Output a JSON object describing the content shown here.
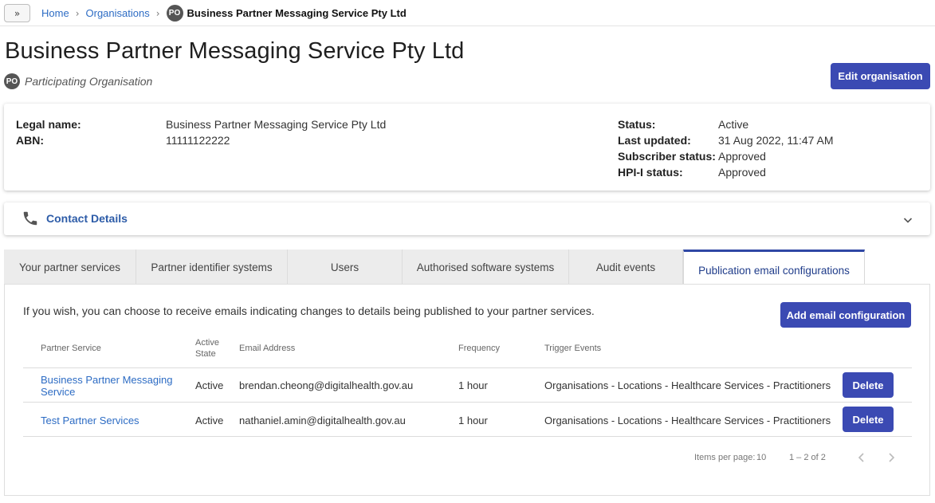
{
  "breadcrumb": {
    "expand_label": "»",
    "home": "Home",
    "organisations": "Organisations",
    "badge": "PO",
    "current": "Business Partner Messaging Service Pty Ltd"
  },
  "header": {
    "title": "Business Partner Messaging Service Pty Ltd",
    "badge": "PO",
    "subtitle": "Participating Organisation",
    "edit_label": "Edit organisation"
  },
  "details": {
    "legal_name_label": "Legal name:",
    "legal_name": "Business Partner Messaging Service Pty Ltd",
    "abn_label": "ABN:",
    "abn": "11111122222",
    "status_label": "Status:",
    "status": "Active",
    "last_updated_label": "Last updated:",
    "last_updated": "31 Aug 2022, 11:47 AM",
    "subscriber_status_label": "Subscriber status:",
    "subscriber_status": "Approved",
    "hpii_status_label": "HPI-I status:",
    "hpii_status": "Approved"
  },
  "contact": {
    "label": "Contact Details"
  },
  "tabs": [
    {
      "label": "Your partner services"
    },
    {
      "label": "Partner identifier systems"
    },
    {
      "label": "Users"
    },
    {
      "label": "Authorised software systems"
    },
    {
      "label": "Audit events"
    },
    {
      "label": "Publication email configurations"
    }
  ],
  "panel": {
    "intro": "If you wish, you can choose to receive emails indicating changes to details being published to your partner services.",
    "add_label": "Add email configuration",
    "columns": {
      "service": "Partner Service",
      "active_line1": "Active",
      "active_line2": "State",
      "email": "Email Address",
      "frequency": "Frequency",
      "events": "Trigger Events"
    },
    "rows": [
      {
        "service_line1": "Business Partner Messaging",
        "service_line2": "Service",
        "state": "Active",
        "email": "brendan.cheong@digitalhealth.gov.au",
        "frequency": "1 hour",
        "events": "Organisations - Locations - Healthcare Services - Practitioners",
        "delete_label": "Delete"
      },
      {
        "service_line1": "Test Partner Services",
        "state": "Active",
        "email": "nathaniel.amin@digitalhealth.gov.au",
        "frequency": "1 hour",
        "events": "Organisations - Locations - Healthcare Services - Practitioners",
        "delete_label": "Delete"
      }
    ],
    "paginator": {
      "items_per_page_label": "Items per page:",
      "items_per_page": "10",
      "range": "1 – 2 of 2"
    }
  }
}
